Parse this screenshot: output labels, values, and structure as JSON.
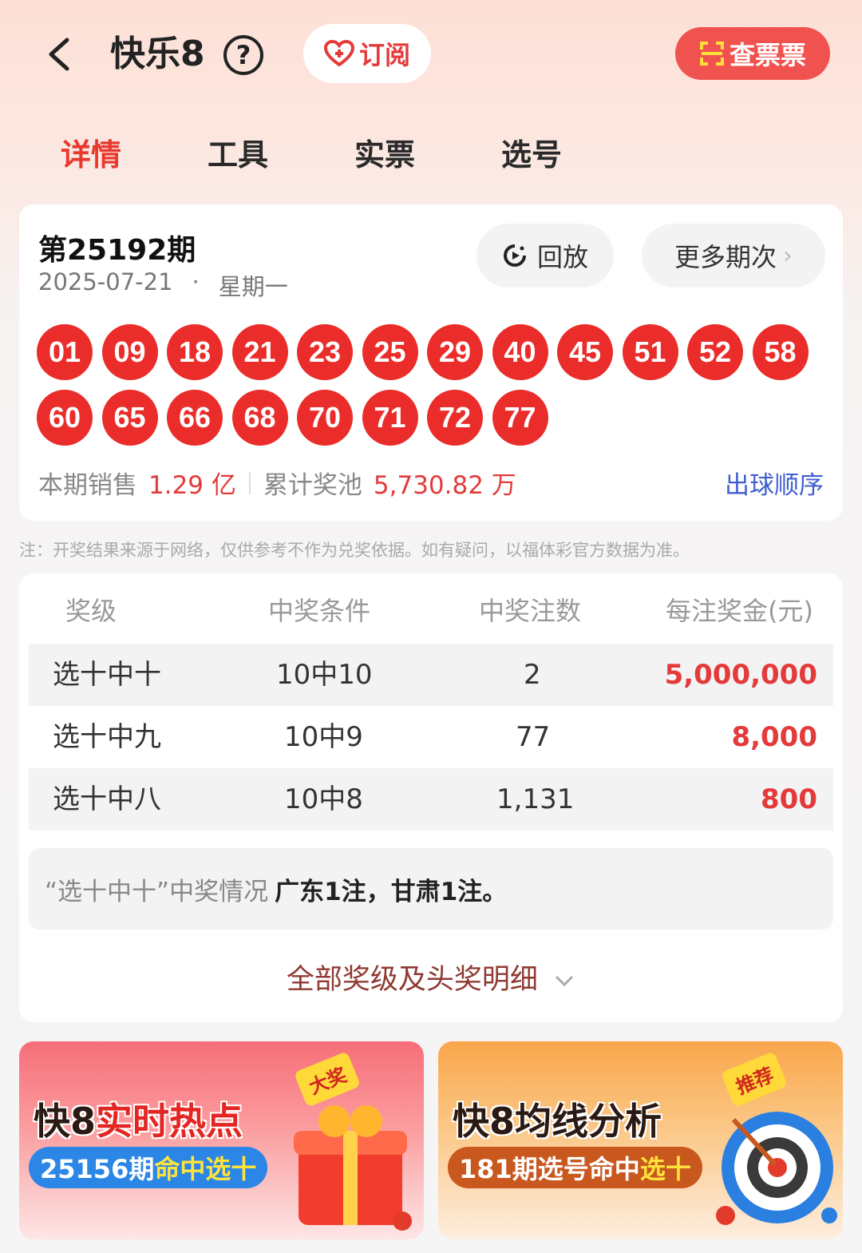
{
  "header": {
    "title": "快乐8",
    "help": "?",
    "subscribe_label": "订阅",
    "check_ticket_label": "查票票"
  },
  "tabs": [
    {
      "label": "详情",
      "active": true
    },
    {
      "label": "工具",
      "active": false
    },
    {
      "label": "实票",
      "active": false
    },
    {
      "label": "选号",
      "active": false
    }
  ],
  "draw": {
    "period": "第25192期",
    "date": "2025-07-21",
    "dot": "·",
    "weekday": "星期一",
    "replay_label": "回放",
    "more_label": "更多期次",
    "more_arrow": "›",
    "numbers": [
      "01",
      "09",
      "18",
      "21",
      "23",
      "25",
      "29",
      "40",
      "45",
      "51",
      "52",
      "58",
      "60",
      "65",
      "66",
      "68",
      "70",
      "71",
      "72",
      "77"
    ],
    "sales_label": "本期销售",
    "sales_value": "1.29 亿",
    "pool_label": "累计奖池",
    "pool_value": "5,730.82 万",
    "order_link": "出球顺序"
  },
  "note": "注：开奖结果来源于网络，仅供参考不作为兑奖依据。如有疑问，以福体彩官方数据为准。",
  "prize_table": {
    "headers": [
      "奖级",
      "中奖条件",
      "中奖注数",
      "每注奖金(元)"
    ],
    "rows": [
      {
        "level": "选十中十",
        "condition": "10中10",
        "count": "2",
        "amount": "5,000,000"
      },
      {
        "level": "选十中九",
        "condition": "10中9",
        "count": "77",
        "amount": "8,000"
      },
      {
        "level": "选十中八",
        "condition": "10中8",
        "count": "1,131",
        "amount": "800"
      }
    ],
    "summary_label": "“选十中十”中奖情况",
    "summary_value": "广东1注，甘肃1注。",
    "expand_label": "全部奖级及头奖明细"
  },
  "banners": [
    {
      "title_a": "快8",
      "title_b": "实时热点",
      "pill_a": "25156期",
      "pill_b": "命中选十",
      "badge": "大奖"
    },
    {
      "title_a": "快8",
      "title_b": "均线分析",
      "pill_a": "181期选号命中",
      "pill_b": "选十",
      "badge": "推荐"
    }
  ],
  "colors": {
    "accent": "#e8392f",
    "ball": "#ea2d2a",
    "link": "#3f5fd0"
  }
}
